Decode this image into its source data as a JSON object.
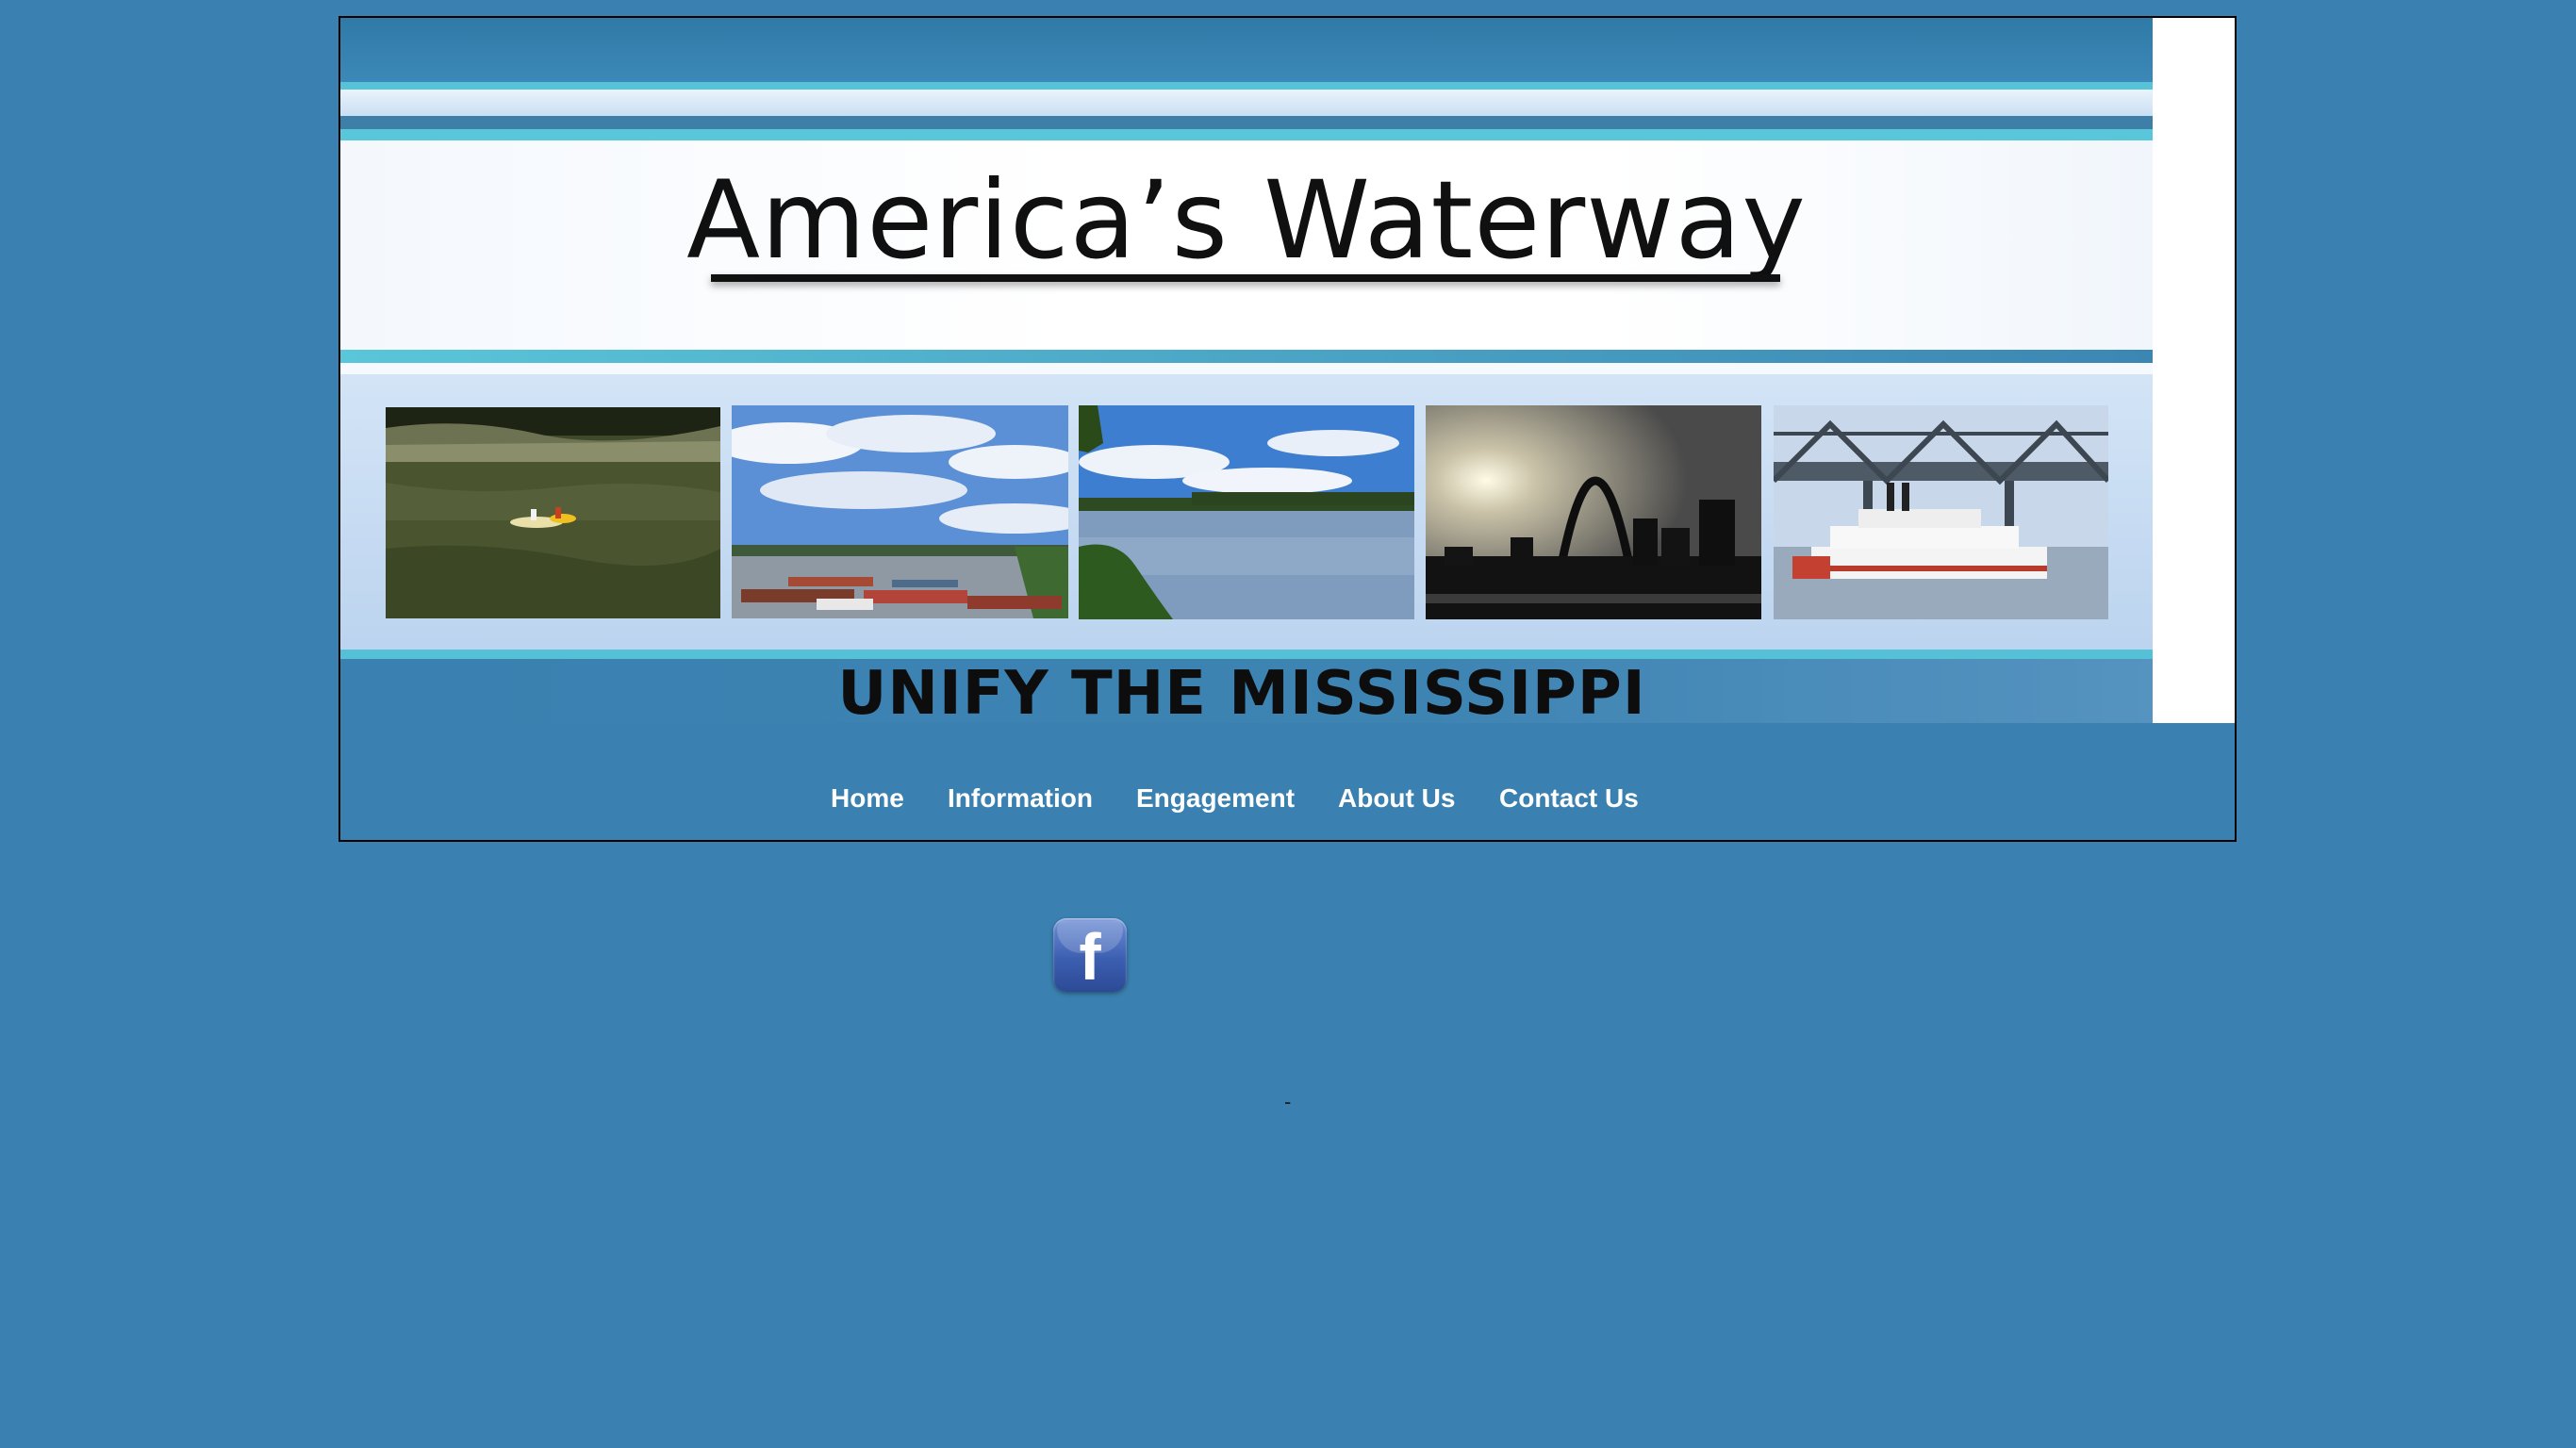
{
  "header": {
    "title": "America’s Waterway",
    "tagline": "UNIFY THE MISSISSIPPI"
  },
  "photos": [
    {
      "name": "kayak-on-river"
    },
    {
      "name": "barges-on-river"
    },
    {
      "name": "river-view"
    },
    {
      "name": "gateway-arch-skyline"
    },
    {
      "name": "steamboat-under-bridge"
    }
  ],
  "nav": {
    "items": [
      {
        "label": "Home"
      },
      {
        "label": "Information"
      },
      {
        "label": "Engagement"
      },
      {
        "label": "About Us"
      },
      {
        "label": "Contact Us"
      }
    ]
  },
  "social": {
    "facebook_glyph": "f",
    "icon": "facebook-icon"
  },
  "footer": {
    "dash": "-"
  },
  "colors": {
    "page_background": "#3a80b0",
    "title_text": "#101010",
    "nav_text": "#ffffff",
    "accent_cyan": "#56c3d8"
  }
}
